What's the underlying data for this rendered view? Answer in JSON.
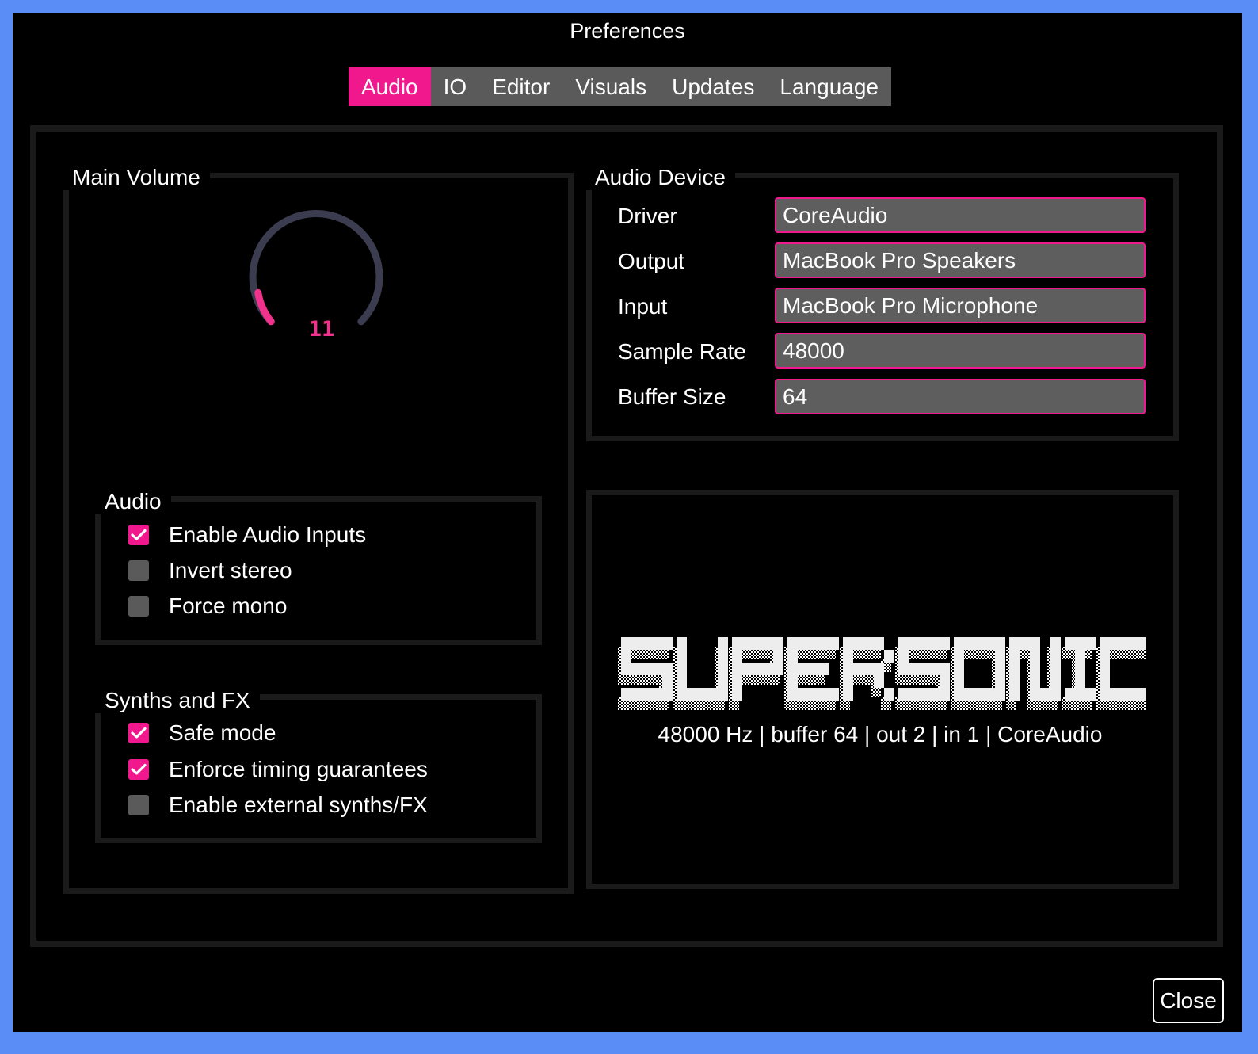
{
  "window": {
    "title": "Preferences",
    "close_label": "Close"
  },
  "tabs": [
    {
      "label": "Audio",
      "active": true
    },
    {
      "label": "IO",
      "active": false
    },
    {
      "label": "Editor",
      "active": false
    },
    {
      "label": "Visuals",
      "active": false
    },
    {
      "label": "Updates",
      "active": false
    },
    {
      "label": "Language",
      "active": false
    }
  ],
  "main_volume": {
    "title": "Main Volume",
    "value": "11",
    "accent": "#f0328c"
  },
  "audio_group": {
    "title": "Audio",
    "options": [
      {
        "label": "Enable Audio Inputs",
        "checked": true
      },
      {
        "label": "Invert stereo",
        "checked": false
      },
      {
        "label": "Force mono",
        "checked": false
      }
    ]
  },
  "synths_group": {
    "title": "Synths and FX",
    "options": [
      {
        "label": "Safe mode",
        "checked": true
      },
      {
        "label": "Enforce timing guarantees",
        "checked": true
      },
      {
        "label": "Enable external synths/FX",
        "checked": false
      }
    ]
  },
  "audio_device": {
    "title": "Audio Device",
    "fields": [
      {
        "label": "Driver",
        "value": "CoreAudio"
      },
      {
        "label": "Output",
        "value": "MacBook Pro Speakers"
      },
      {
        "label": "Input",
        "value": "MacBook Pro Microphone"
      },
      {
        "label": "Sample Rate",
        "value": "48000"
      },
      {
        "label": "Buffer Size",
        "value": "64"
      }
    ]
  },
  "supersonic": {
    "logo_text": "SUPERSONIC",
    "status": "48000 Hz | buffer 64 | out 2 | in 1 | CoreAudio"
  },
  "colors": {
    "accent": "#f0188c",
    "frame": "#5b8df7",
    "field_bg": "#5e5e5e",
    "group_border": "#1a1a1a"
  }
}
